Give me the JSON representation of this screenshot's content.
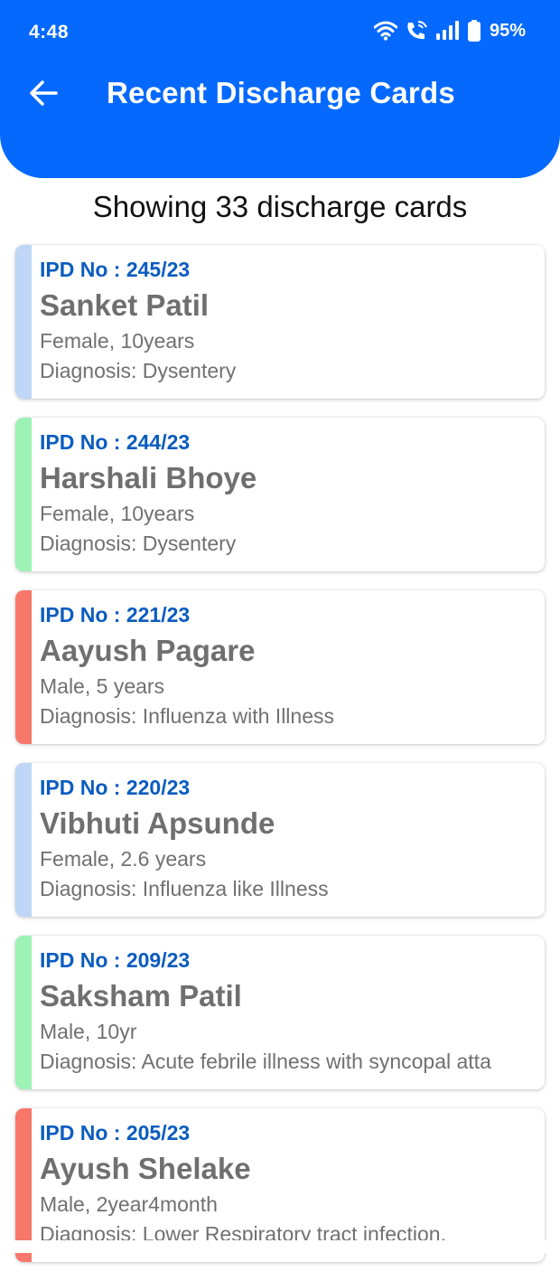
{
  "status_bar": {
    "time": "4:48",
    "battery": "95%",
    "icons": [
      "wifi-icon",
      "wifi-call-icon",
      "signal-icon",
      "battery-icon"
    ]
  },
  "header": {
    "title": "Recent Discharge Cards",
    "back_icon": "arrow-left-icon"
  },
  "summary": {
    "text": "Showing 33 discharge cards"
  },
  "colors": {
    "appbar": "#0569FF",
    "ipd_text": "#0B5CBF",
    "stripe_blue": "#BFD6F6",
    "stripe_green": "#9CF3B5",
    "stripe_red": "#F7776B"
  },
  "cards": [
    {
      "ipd": "IPD No : 245/23",
      "name": "Sanket Patil",
      "info": "Female, 10years",
      "diagnosis": "Diagnosis: Dysentery",
      "stripe": "#BFD6F6"
    },
    {
      "ipd": "IPD No : 244/23",
      "name": "Harshali Bhoye",
      "info": "Female, 10years",
      "diagnosis": "Diagnosis: Dysentery",
      "stripe": "#9CF3B5"
    },
    {
      "ipd": "IPD No : 221/23",
      "name": "Aayush Pagare",
      "info": "Male, 5 years",
      "diagnosis": "Diagnosis: Influenza with Illness",
      "stripe": "#F7776B"
    },
    {
      "ipd": "IPD No : 220/23",
      "name": "Vibhuti Apsunde",
      "info": "Female, 2.6 years",
      "diagnosis": "Diagnosis: Influenza like Illness",
      "stripe": "#BFD6F6"
    },
    {
      "ipd": "IPD No : 209/23",
      "name": "Saksham Patil",
      "info": "Male, 10yr",
      "diagnosis": "Diagnosis: Acute febrile illness with syncopal atta",
      "stripe": "#9CF3B5"
    },
    {
      "ipd": "IPD No : 205/23",
      "name": "Ayush Shelake",
      "info": "Male, 2year4month",
      "diagnosis": "Diagnosis: Lower Respiratory tract infection,",
      "stripe": "#F7776B"
    }
  ]
}
